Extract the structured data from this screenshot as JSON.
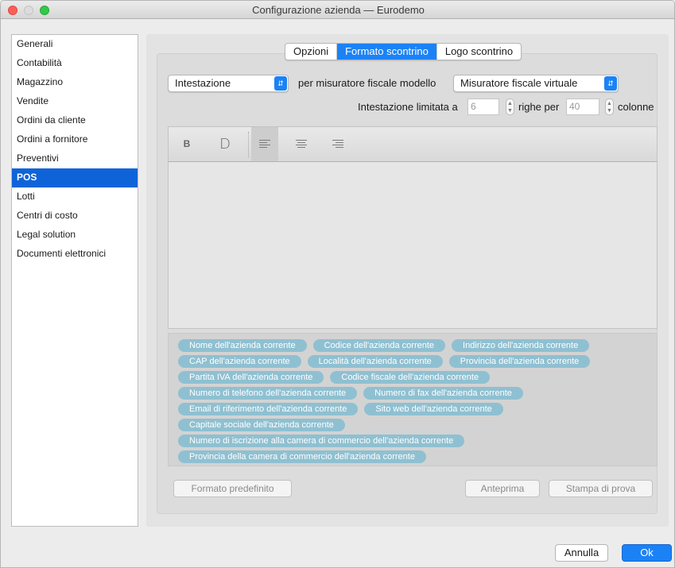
{
  "window": {
    "title": "Configurazione azienda — Eurodemo"
  },
  "sidebar": {
    "items": [
      {
        "label": "Generali"
      },
      {
        "label": "Contabilità"
      },
      {
        "label": "Magazzino"
      },
      {
        "label": "Vendite"
      },
      {
        "label": "Ordini da cliente"
      },
      {
        "label": "Ordini a fornitore"
      },
      {
        "label": "Preventivi"
      },
      {
        "label": "POS"
      },
      {
        "label": "Lotti"
      },
      {
        "label": "Centri di costo"
      },
      {
        "label": "Legal solution"
      },
      {
        "label": "Documenti elettronici"
      }
    ],
    "selected": "POS"
  },
  "tabs": [
    {
      "label": "Opzioni"
    },
    {
      "label": "Formato scontrino"
    },
    {
      "label": "Logo scontrino"
    }
  ],
  "active_tab": "Formato scontrino",
  "section_select": {
    "value": "Intestazione"
  },
  "model_label": "per misuratore fiscale modello",
  "model_select": {
    "value": "Misuratore fiscale virtuale"
  },
  "limits": {
    "label": "Intestazione limitata a",
    "rows": "6",
    "rows_label": "righe per",
    "cols": "40",
    "cols_label": "colonne"
  },
  "toolbar": {
    "bold_label": "B",
    "double_label": "D",
    "icons": [
      "align-left-icon",
      "align-center-icon",
      "align-right-icon"
    ]
  },
  "tokens": [
    [
      "Nome dell'azienda corrente",
      "Codice dell'azienda corrente",
      "Indirizzo dell'azienda corrente"
    ],
    [
      "CAP dell'azienda corrente",
      "Località dell'azienda corrente",
      "Provincia dell'azienda corrente"
    ],
    [
      "Partita IVA dell'azienda corrente",
      "Codice fiscale dell'azienda corrente"
    ],
    [
      "Numero di telefono dell'azienda corrente",
      "Numero di fax dell'azienda corrente"
    ],
    [
      "Email di riferimento dell'azienda corrente",
      "Sito web dell'azienda corrente"
    ],
    [
      "Capitale sociale dell'azienda corrente"
    ],
    [
      "Numero di iscrizione alla camera di commercio dell'azienda corrente"
    ],
    [
      "Provincia della camera di commercio dell'azienda corrente"
    ]
  ],
  "buttons": {
    "default_format": "Formato predefinito",
    "preview": "Anteprima",
    "test_print": "Stampa di prova",
    "cancel": "Annulla",
    "ok": "Ok"
  },
  "colors": {
    "accent": "#1b82f6",
    "selection": "#0f63d9",
    "token": "#8fc0d1"
  }
}
